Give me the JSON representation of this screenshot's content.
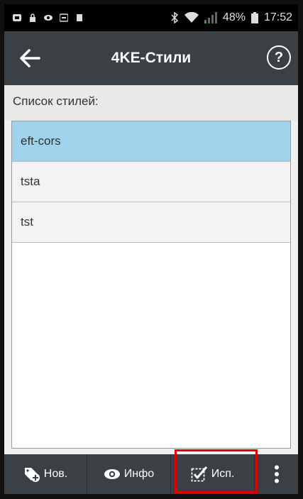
{
  "status_bar": {
    "battery": "48%",
    "time": "17:52"
  },
  "header": {
    "title": "4KE-Стили",
    "help_glyph": "?"
  },
  "list": {
    "header": "Список стилей:",
    "items": [
      "eft-cors",
      "tsta",
      "tst"
    ],
    "selected": "eft-cors"
  },
  "toolbar": {
    "new_label": "Нов.",
    "info_label": "Инфо",
    "use_label": "Исп."
  },
  "colors": {
    "selected_row": "#9fd3eb",
    "action_bar": "#3b4044",
    "highlight": "#e00000"
  }
}
